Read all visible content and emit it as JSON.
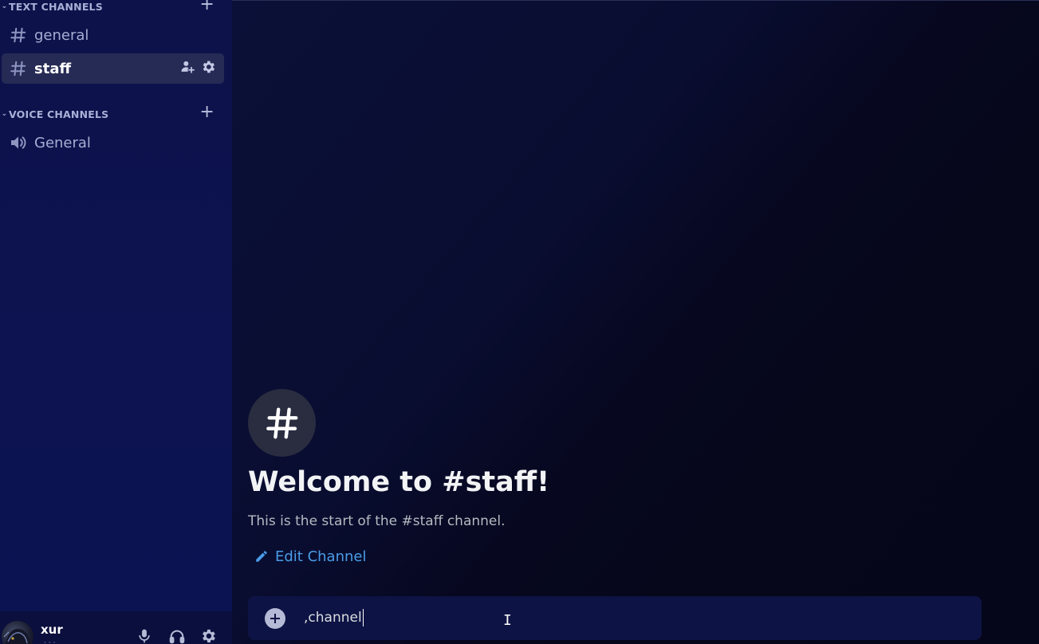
{
  "sidebar": {
    "text_category": {
      "label": "TEXT CHANNELS",
      "chevron": "chevron-down-icon",
      "add_icon": "plus-icon"
    },
    "voice_category": {
      "label": "VOICE CHANNELS",
      "chevron": "chevron-down-icon",
      "add_icon": "plus-icon"
    },
    "text_channels": [
      {
        "name": "general",
        "icon": "hashtag-icon",
        "active": false
      },
      {
        "name": "staff",
        "icon": "hashtag-icon",
        "active": true,
        "actions": [
          "invite-icon",
          "gear-icon"
        ]
      }
    ],
    "voice_channels": [
      {
        "name": "General",
        "icon": "speaker-icon"
      }
    ]
  },
  "user_panel": {
    "username": "xur",
    "buttons": [
      "microphone-icon",
      "headphones-icon",
      "gear-icon"
    ]
  },
  "main": {
    "welcome_icon": "hashtag-icon",
    "welcome_title": "Welcome to #staff!",
    "welcome_subtitle": "This is the start of the #staff channel.",
    "edit_channel_label": "Edit Channel",
    "composer": {
      "value": ",channel",
      "add_icon": "plus-circle-icon"
    }
  },
  "colors": {
    "sidebar_bg": "#0c1350",
    "main_bg": "#07081f",
    "active_channel_bg": "#262b55",
    "link": "#4a9ce8",
    "heading": "#f2f3f5"
  }
}
